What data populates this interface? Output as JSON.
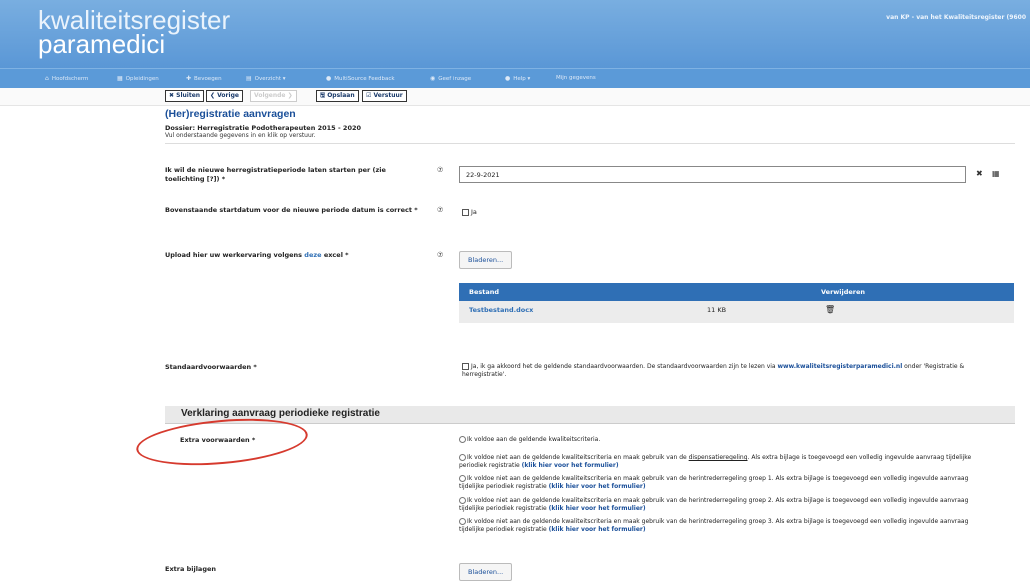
{
  "header": {
    "logo_line1": "kwaliteitsregister",
    "logo_line2": "paramedici",
    "user_info": "van KP - van het Kwaliteitsregister (9600"
  },
  "nav": [
    {
      "icon": "home-icon",
      "glyph": "⌂",
      "label": "Hoofdscherm"
    },
    {
      "icon": "grid-icon",
      "glyph": "▦",
      "label": "Opleidingen"
    },
    {
      "icon": "plus-icon",
      "glyph": "✚",
      "label": "Bevoegen"
    },
    {
      "icon": "doc-icon",
      "glyph": "▤",
      "label": "Overzicht ▾"
    },
    {
      "icon": "chat-icon",
      "glyph": "●",
      "label": "MultiSource Feedback"
    },
    {
      "icon": "eye-icon",
      "glyph": "◉",
      "label": "Geef inzage"
    },
    {
      "icon": "help-icon",
      "glyph": "●",
      "label": "Help ▾"
    },
    {
      "icon": "user-icon",
      "glyph": "",
      "label": "Mijn gegevens"
    }
  ],
  "toolbar": {
    "close": "✖ Sluiten",
    "prev": "❮ Vorige",
    "next": "Volgende ❯",
    "save": "🖫 Opslaan",
    "submit": "☑ Verstuur"
  },
  "page": {
    "title": "(Her)registratie aanvragen",
    "dossier": "Dossier: Herregistratie Podotherapeuten 2015 - 2020",
    "hint": "Vul onderstaande gegevens in en klik op verstuur."
  },
  "form": {
    "start_label": "Ik wil de nieuwe herregistratieperiode laten starten per (zie toelichting [?]) *",
    "start_value": "22-9-2021",
    "confirm_label": "Bovenstaande startdatum voor de nieuwe periode datum is correct  *",
    "confirm_option": "Ja",
    "upload_label_pre": "Upload hier uw werkervaring volgens ",
    "upload_label_link": "deze",
    "upload_label_post": " excel *",
    "browse": "Bladeren...",
    "table_headers": {
      "file": "Bestand",
      "delete": "Verwijderen"
    },
    "file_name": "Testbestand.docx",
    "file_size": "11 KB",
    "terms_label": "Standaardvoorwaarden *",
    "terms_text_pre": "Ja, ik ga akkoord het de geldende standaardvoorwaarden. De standaardvoorwaarden zijn te lezen via ",
    "terms_link": "www.kwaliteitsregisterparamedici.nl",
    "terms_text_post": " onder 'Registratie & herregistratie'.",
    "section_title": "Verklaring aanvraag periodieke registratie",
    "extra_label": "Extra voorwaarden *",
    "radio1": "Ik voldoe aan de geldende kwaliteitscriteria.",
    "radio2_pre": "Ik voldoe niet aan de geldende kwaliteitscriteria en maak gebruik van de ",
    "radio2_u": "dispensatieregeling",
    "radio2_post": ". Als extra bijlage is toegevoegd een volledig ingevulde aanvraag tijdelijke periodiek registratie ",
    "radio3": "Ik voldoe niet aan de geldende kwaliteitscriteria en maak gebruik van de herintrederregeling groep 1. Als extra bijlage is toegevoegd een volledig ingevulde aanvraag tijdelijke periodiek registratie ",
    "radio4": "Ik voldoe niet aan de geldende kwaliteitscriteria en maak gebruik van de herintrederregeling groep 2. Als extra bijlage is toegevoegd een volledig ingevulde aanvraag tijdelijke periodiek registratie ",
    "radio5": "Ik voldoe niet aan de geldende kwaliteitscriteria en maak gebruik van de herintrederregeling groep 3. Als extra bijlage is toegevoegd een volledig ingevulde aanvraag tijdelijke periodiek registratie ",
    "form_link": "(klik hier voor het formulier)",
    "extra_attach_label": "Extra bijlagen"
  },
  "colors": {
    "header": "#5a97d6",
    "accent": "#2f6fb5",
    "annotation": "#d63a2e"
  }
}
